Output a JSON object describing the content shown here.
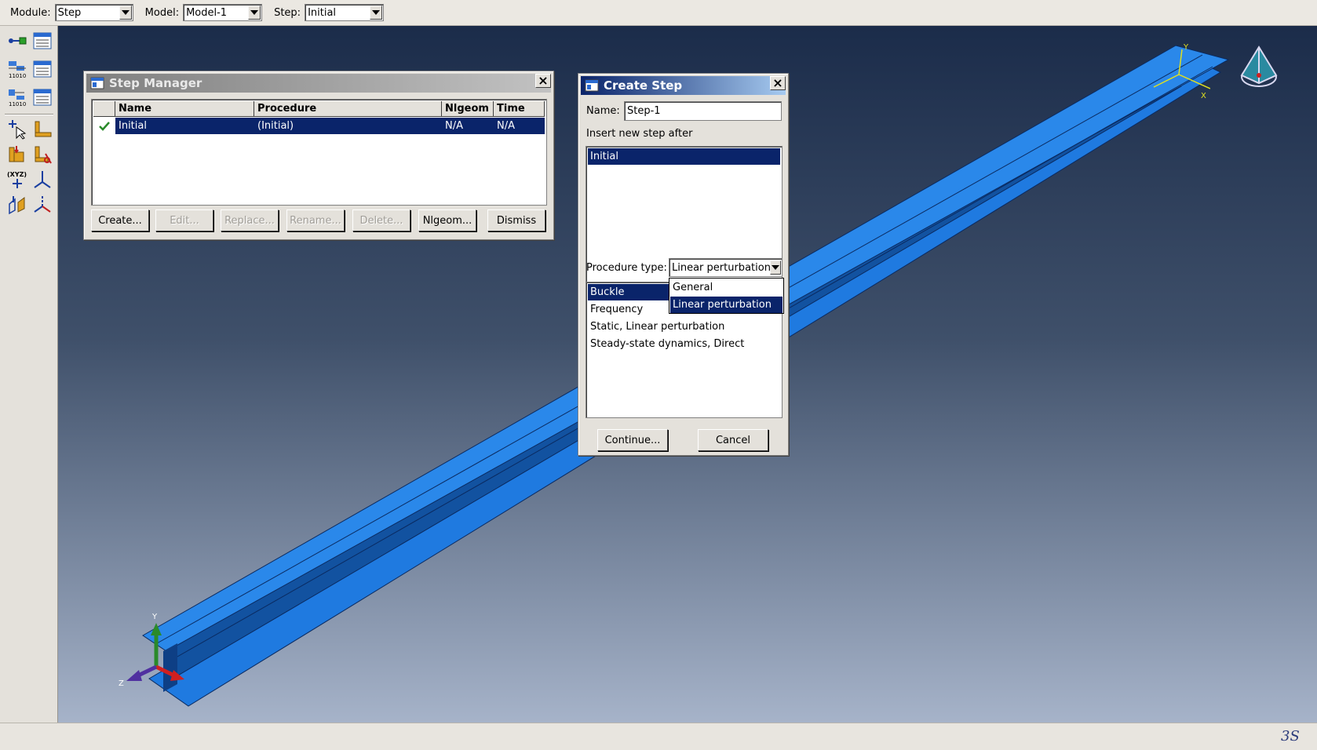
{
  "topbar": {
    "module_label": "Module:",
    "module_value": "Step",
    "model_label": "Model:",
    "model_value": "Model-1",
    "step_label": "Step:",
    "step_value": "Initial"
  },
  "toolbox": {
    "tools": [
      "create-step-icon",
      "step-manager-icon",
      "create-field-output-icon",
      "field-output-manager-icon",
      "create-history-output-icon",
      "history-output-manager-icon",
      "select-query-icon",
      "load-icon",
      "boundary-condition-icon",
      "predefined-field-icon",
      "datum-point-icon",
      "datum-axis-icon",
      "datum-plane-icon",
      "datum-csys-icon"
    ]
  },
  "step_manager": {
    "title": "Step Manager",
    "columns": [
      "Name",
      "Procedure",
      "Nlgeom",
      "Time"
    ],
    "rows": [
      {
        "name": "Initial",
        "procedure": "(Initial)",
        "nlgeom": "N/A",
        "time": "N/A",
        "checked": true
      }
    ],
    "buttons": {
      "create": "Create...",
      "edit": "Edit...",
      "replace": "Replace...",
      "rename": "Rename...",
      "delete": "Delete...",
      "nlgeom": "Nlgeom...",
      "dismiss": "Dismiss"
    }
  },
  "create_step": {
    "title": "Create Step",
    "name_label": "Name:",
    "name_value": "Step-1",
    "insert_label": "Insert new step after",
    "insert_items": [
      "Initial"
    ],
    "procedure_label": "Procedure type:",
    "procedure_value": "Linear perturbation",
    "procedure_options": [
      "General",
      "Linear perturbation"
    ],
    "procedures": [
      "Buckle",
      "Frequency",
      "Static, Linear perturbation",
      "Steady-state dynamics, Direct"
    ],
    "continue_label": "Continue...",
    "cancel_label": "Cancel"
  },
  "triad": {
    "x": "X",
    "y": "Y",
    "z": "Z"
  },
  "colors": {
    "selection": "#0a246a",
    "beam": "#1f7ae0",
    "check": "#2a8a2a"
  }
}
